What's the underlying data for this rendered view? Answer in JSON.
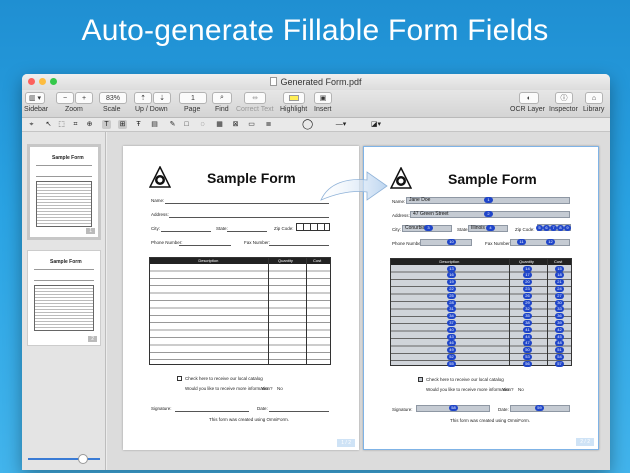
{
  "headline": "Auto-generate Fillable Form Fields",
  "window": {
    "title": "Generated Form.pdf"
  },
  "toolbar": {
    "zoom_value": "83%",
    "page_value": "1",
    "labels": {
      "sidebar": "Sidebar",
      "zoom": "Zoom",
      "scale": "Scale",
      "up_down": "Up / Down",
      "page": "Page",
      "find": "Find",
      "correct_text": "Correct Text",
      "highlight": "Highlight",
      "insert": "Insert",
      "ocr_layer": "OCR Layer",
      "inspector": "Inspector",
      "library": "Library"
    }
  },
  "form": {
    "title": "Sample Form",
    "name": "Name:",
    "address": "Address:",
    "city": "City:",
    "state": "State:",
    "zip": "Zip Code:",
    "phone": "Phone Number:",
    "fax": "Fax Number:",
    "columns": [
      "Description",
      "Quantity",
      "Cost"
    ],
    "catalog": "Check here to receive our local catalog",
    "more_info": "Would you like to receive more information?",
    "yes": "Yes",
    "no": "No",
    "signature": "Signature:",
    "date": "Date:",
    "created": "This form was created using OmniForm."
  },
  "filled": {
    "name": "Jane Doe",
    "address": "47 Green Street",
    "city": "Conurbia",
    "state": "Illinois",
    "badges": {
      "name": "1",
      "address": "2",
      "city": "3",
      "state": "4",
      "zip": [
        "5",
        "6",
        "7",
        "8",
        "9"
      ],
      "phone": "10",
      "fax1": "11",
      "fax2": "12",
      "signature": "58",
      "date": "59"
    },
    "desc_badges": [
      "13",
      "16",
      "19",
      "22",
      "25",
      "28",
      "31",
      "34",
      "37",
      "40",
      "43",
      "46",
      "49",
      "52",
      "55"
    ],
    "qty_badges": [
      "14",
      "17",
      "20",
      "23",
      "26",
      "29",
      "32",
      "35",
      "38",
      "41",
      "44",
      "47",
      "50",
      "53",
      "56"
    ],
    "cost_badges": [
      "15",
      "18",
      "21",
      "24",
      "27",
      "30",
      "33",
      "36",
      "39",
      "42",
      "45",
      "48",
      "51",
      "54",
      "57"
    ]
  },
  "page_indicators": {
    "p1": "1 / 2",
    "p2": "2 / 2"
  },
  "thumbs": {
    "title": "Sample Form",
    "p1": "1",
    "p2": "2"
  }
}
